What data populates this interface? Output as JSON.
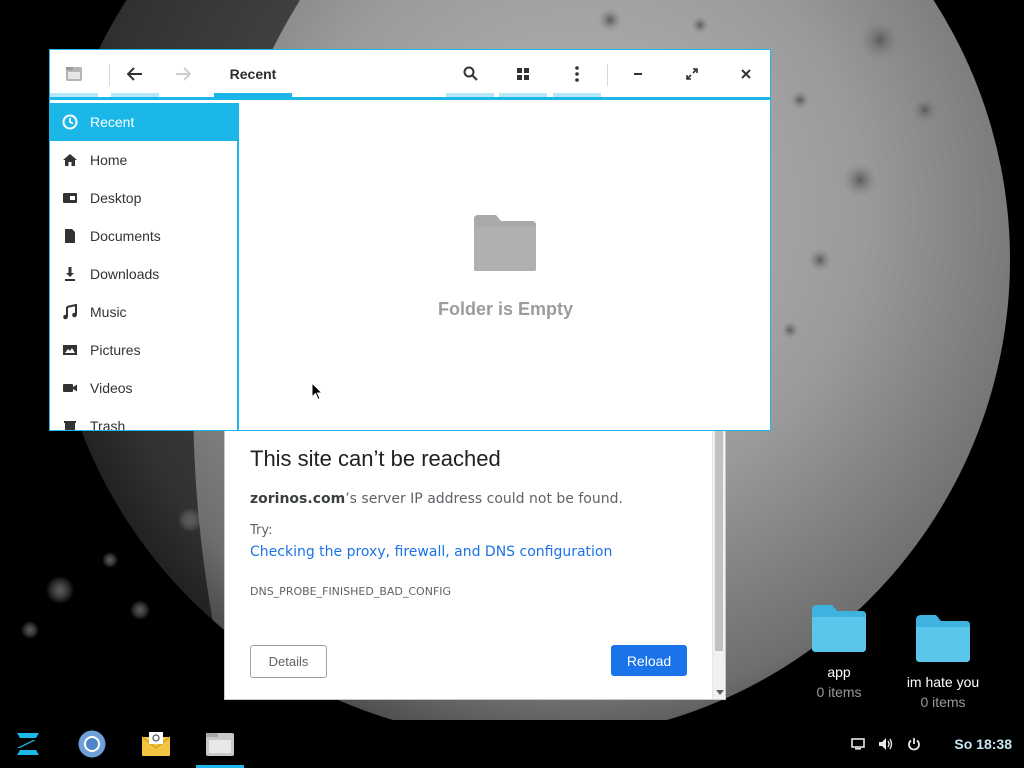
{
  "colors": {
    "accent": "#1ab7e8",
    "accent_light": "#b5e8f7",
    "link_blue": "#1a73e8",
    "folder_gray": "#a9a9a9",
    "desktop_folder": "#5bc6ec"
  },
  "files_window": {
    "path_label": "Recent",
    "header_icons": [
      "files-app-icon",
      "back-arrow-icon",
      "forward-arrow-icon",
      "search-icon",
      "grid-view-icon",
      "kebab-menu-icon",
      "minimize-icon",
      "maximize-icon",
      "close-icon"
    ],
    "sidebar": [
      {
        "label": "Recent",
        "icon": "clock-icon",
        "active": true
      },
      {
        "label": "Home",
        "icon": "home-icon"
      },
      {
        "label": "Desktop",
        "icon": "desktop-icon"
      },
      {
        "label": "Documents",
        "icon": "document-icon"
      },
      {
        "label": "Downloads",
        "icon": "download-icon"
      },
      {
        "label": "Music",
        "icon": "music-note-icon"
      },
      {
        "label": "Pictures",
        "icon": "image-icon"
      },
      {
        "label": "Videos",
        "icon": "video-camera-icon"
      },
      {
        "label": "Trash",
        "icon": "trash-icon"
      }
    ],
    "empty_message": "Folder is Empty"
  },
  "chrome_error": {
    "title": "This site can’t be reached",
    "domain": "zorinos.com",
    "message_suffix": "’s server IP address could not be found.",
    "try_label": "Try:",
    "suggestion_link": "Checking the proxy, firewall, and DNS configuration",
    "error_code": "DNS_PROBE_FINISHED_BAD_CONFIG",
    "details_button": "Details",
    "reload_button": "Reload"
  },
  "desktop_icons": [
    {
      "name": "app",
      "subtitle": "0 items"
    },
    {
      "name": "im hate you",
      "subtitle": "0 items"
    }
  ],
  "taskbar": {
    "apps": [
      "zorin-menu-icon",
      "chromium-icon",
      "mail-icon",
      "files-icon"
    ],
    "tray_icons": [
      "display-icon",
      "volume-icon",
      "power-icon"
    ],
    "clock": "So 18:38"
  }
}
